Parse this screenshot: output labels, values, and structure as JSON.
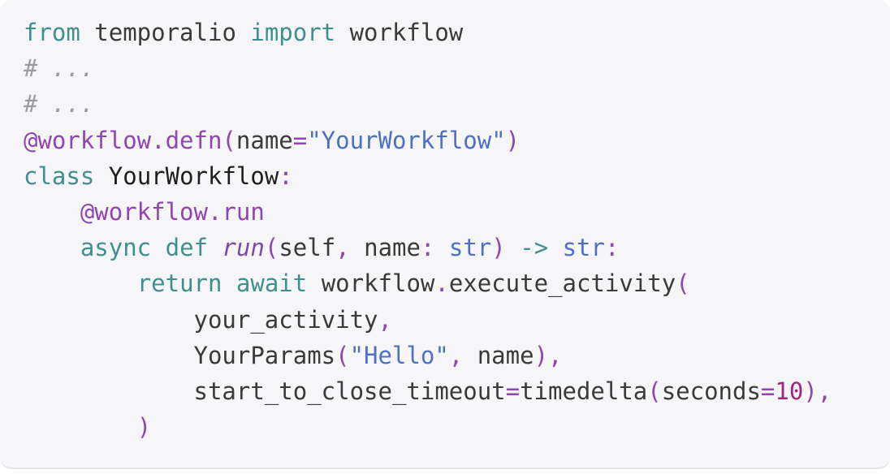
{
  "code": {
    "language": "python",
    "lines": [
      [
        {
          "t": "from",
          "c": "kw"
        },
        {
          "t": " temporalio ",
          "c": "plain"
        },
        {
          "t": "import",
          "c": "kw"
        },
        {
          "t": " workflow",
          "c": "plain"
        }
      ],
      [
        {
          "t": "# ...",
          "c": "cm"
        }
      ],
      [
        {
          "t": "# ...",
          "c": "cm"
        }
      ],
      [
        {
          "t": "@workflow.defn(",
          "c": "dec"
        },
        {
          "t": "name",
          "c": "plain"
        },
        {
          "t": "=",
          "c": "op"
        },
        {
          "t": "\"YourWorkflow\"",
          "c": "str"
        },
        {
          "t": ")",
          "c": "dec"
        }
      ],
      [
        {
          "t": "class",
          "c": "kw"
        },
        {
          "t": " YourWorkflow",
          "c": "cls"
        },
        {
          "t": ":",
          "c": "op"
        }
      ],
      [
        {
          "t": "    ",
          "c": "plain"
        },
        {
          "t": "@workflow.run",
          "c": "dec"
        }
      ],
      [
        {
          "t": "    ",
          "c": "plain"
        },
        {
          "t": "async",
          "c": "kw"
        },
        {
          "t": " ",
          "c": "plain"
        },
        {
          "t": "def",
          "c": "kw"
        },
        {
          "t": " ",
          "c": "plain"
        },
        {
          "t": "run",
          "c": "fn"
        },
        {
          "t": "(",
          "c": "op"
        },
        {
          "t": "self",
          "c": "plain"
        },
        {
          "t": ", ",
          "c": "op"
        },
        {
          "t": "name",
          "c": "plain"
        },
        {
          "t": ": ",
          "c": "op"
        },
        {
          "t": "str",
          "c": "ty"
        },
        {
          "t": ") ",
          "c": "op"
        },
        {
          "t": "->",
          "c": "kw"
        },
        {
          "t": " ",
          "c": "plain"
        },
        {
          "t": "str",
          "c": "ty"
        },
        {
          "t": ":",
          "c": "op"
        }
      ],
      [
        {
          "t": "        ",
          "c": "plain"
        },
        {
          "t": "return",
          "c": "kw"
        },
        {
          "t": " ",
          "c": "plain"
        },
        {
          "t": "await",
          "c": "kw"
        },
        {
          "t": " workflow",
          "c": "plain"
        },
        {
          "t": ".",
          "c": "op"
        },
        {
          "t": "execute_activity",
          "c": "plain"
        },
        {
          "t": "(",
          "c": "op"
        }
      ],
      [
        {
          "t": "            your_activity",
          "c": "plain"
        },
        {
          "t": ",",
          "c": "op"
        }
      ],
      [
        {
          "t": "            YourParams",
          "c": "plain"
        },
        {
          "t": "(",
          "c": "op"
        },
        {
          "t": "\"Hello\"",
          "c": "str"
        },
        {
          "t": ", ",
          "c": "op"
        },
        {
          "t": "name",
          "c": "plain"
        },
        {
          "t": "),",
          "c": "op"
        }
      ],
      [
        {
          "t": "            start_to_close_timeout",
          "c": "plain"
        },
        {
          "t": "=",
          "c": "op"
        },
        {
          "t": "timedelta",
          "c": "plain"
        },
        {
          "t": "(",
          "c": "op"
        },
        {
          "t": "seconds",
          "c": "plain"
        },
        {
          "t": "=",
          "c": "op"
        },
        {
          "t": "10",
          "c": "num"
        },
        {
          "t": "),",
          "c": "op"
        }
      ],
      [
        {
          "t": "        ",
          "c": "plain"
        },
        {
          "t": ")",
          "c": "op"
        }
      ]
    ]
  }
}
